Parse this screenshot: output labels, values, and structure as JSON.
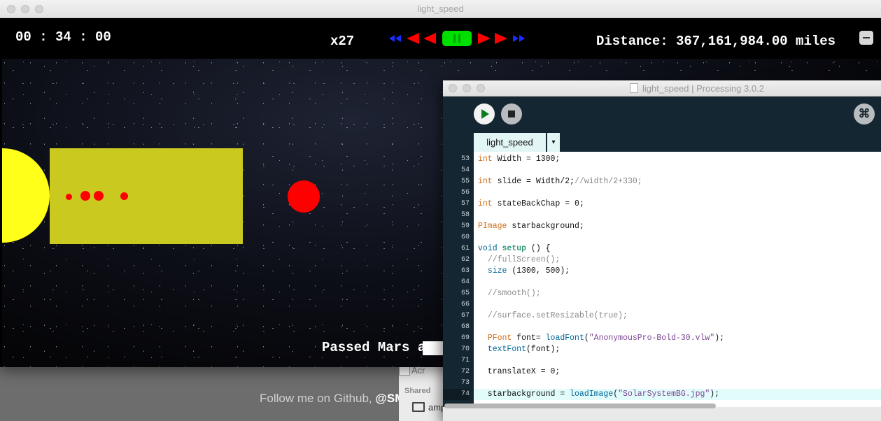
{
  "background": {
    "follow_text": "Follow me on Github, ",
    "follow_handle": "@SM",
    "finder_item_1": "Acr",
    "finder_section": "Shared",
    "finder_item_2": "amp"
  },
  "sketch_window": {
    "title": "light_speed",
    "timer": "00 : 34 : 00",
    "speed": "x27",
    "distance": "Distance: 367,161,984.00 miles",
    "status": "Passed Mars at",
    "colors": {
      "sun": "#ffff1a",
      "ship_bar": "#c9c920",
      "planet": "#ff0000",
      "rewind_fast": "#1a2cff",
      "rewind": "#ff0000",
      "pause": "#00e000",
      "forward": "#ff0000",
      "forward_fast": "#1a2cff"
    },
    "controls": [
      "rewind-fast",
      "rewind",
      "pause",
      "forward",
      "forward-fast"
    ]
  },
  "ide": {
    "title": "light_speed | Processing 3.0.2",
    "tab": "light_speed",
    "tab_menu": "▾",
    "mode_icon": "⌘",
    "code": [
      {
        "n": "53",
        "t": [
          [
            "kw",
            "int"
          ],
          [
            "p",
            " Width = 1300;"
          ]
        ]
      },
      {
        "n": "54",
        "t": []
      },
      {
        "n": "55",
        "t": [
          [
            "kw",
            "int"
          ],
          [
            "p",
            " slide = Width/2;"
          ],
          [
            "cm",
            "//width/2+330;"
          ]
        ]
      },
      {
        "n": "56",
        "t": []
      },
      {
        "n": "57",
        "t": [
          [
            "kw",
            "int"
          ],
          [
            "p",
            " stateBackChap = 0;"
          ]
        ]
      },
      {
        "n": "58",
        "t": []
      },
      {
        "n": "59",
        "t": [
          [
            "kw",
            "PImage"
          ],
          [
            "p",
            " starbackground;"
          ]
        ]
      },
      {
        "n": "60",
        "t": []
      },
      {
        "n": "61",
        "t": [
          [
            "fn",
            "void"
          ],
          [
            "p",
            " "
          ],
          [
            "kwb",
            "setup"
          ],
          [
            "p",
            " () {"
          ]
        ]
      },
      {
        "n": "62",
        "t": [
          [
            "p",
            "  "
          ],
          [
            "cm",
            "//fullScreen();"
          ]
        ]
      },
      {
        "n": "63",
        "t": [
          [
            "p",
            "  "
          ],
          [
            "fn",
            "size"
          ],
          [
            "p",
            " (1300, 500);"
          ]
        ]
      },
      {
        "n": "64",
        "t": []
      },
      {
        "n": "65",
        "t": [
          [
            "p",
            "  "
          ],
          [
            "cm",
            "//smooth();"
          ]
        ]
      },
      {
        "n": "66",
        "t": []
      },
      {
        "n": "67",
        "t": [
          [
            "p",
            "  "
          ],
          [
            "cm",
            "//surface.setResizable(true);"
          ]
        ]
      },
      {
        "n": "68",
        "t": []
      },
      {
        "n": "69",
        "t": [
          [
            "p",
            "  "
          ],
          [
            "kw",
            "PFont"
          ],
          [
            "p",
            " font= "
          ],
          [
            "fn",
            "loadFont"
          ],
          [
            "p",
            "("
          ],
          [
            "str",
            "\"AnonymousPro-Bold-30.vlw\""
          ],
          [
            "p",
            ");"
          ]
        ]
      },
      {
        "n": "70",
        "t": [
          [
            "p",
            "  "
          ],
          [
            "fn",
            "textFont"
          ],
          [
            "p",
            "(font);"
          ]
        ]
      },
      {
        "n": "71",
        "t": []
      },
      {
        "n": "72",
        "t": [
          [
            "p",
            "  translateX = 0;"
          ]
        ]
      },
      {
        "n": "73",
        "t": []
      },
      {
        "n": "74",
        "t": [
          [
            "p",
            "  starbackground = "
          ],
          [
            "fn",
            "loadImage"
          ],
          [
            "p",
            "("
          ],
          [
            "str",
            "\"SolarSystemBG.jpg\""
          ],
          [
            "p",
            ");"
          ]
        ],
        "highlight": true
      }
    ]
  }
}
